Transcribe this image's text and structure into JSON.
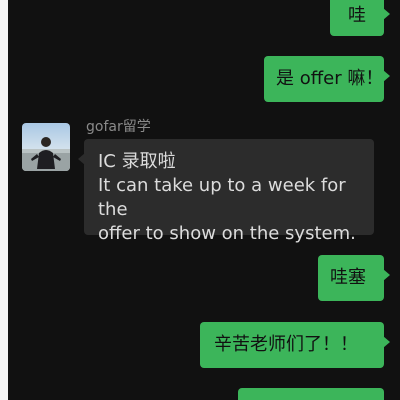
{
  "chat": {
    "messages": [
      {
        "side": "right",
        "text": "哇"
      },
      {
        "side": "right",
        "text": "是 offer 嘛！"
      },
      {
        "side": "left",
        "sender": "gofar留学",
        "lines": [
          "IC 录取啦",
          "It can take up to a week for the",
          "offer to show on the system."
        ]
      },
      {
        "side": "right",
        "text": "哇塞"
      },
      {
        "side": "right",
        "text": "辛苦老师们了！！"
      }
    ]
  },
  "colors": {
    "background": "#111111",
    "outgoing_bubble": "#3cb55a",
    "incoming_bubble": "#2c2c2c",
    "sender_name": "#8a8a8a"
  },
  "icons": {
    "avatar": "profile-photo-avatar"
  }
}
